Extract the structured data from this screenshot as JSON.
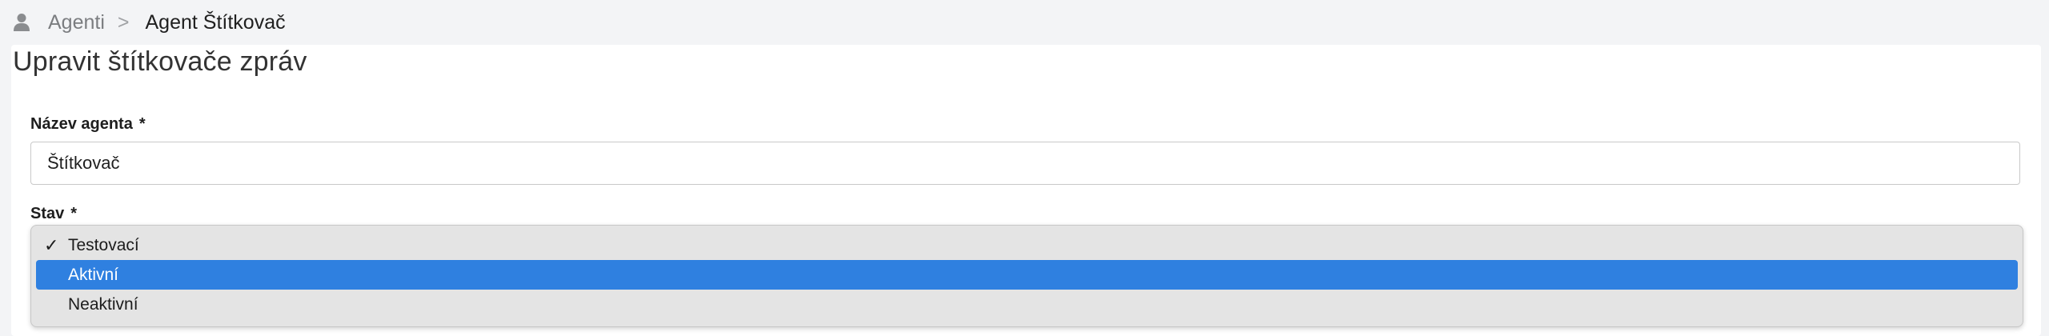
{
  "breadcrumb": {
    "parent": "Agenti",
    "separator": ">",
    "current": "Agent Štítkovač",
    "icon": "user-icon"
  },
  "page": {
    "title": "Upravit štítkovače zpráv"
  },
  "form": {
    "name_label": "Název agenta",
    "name_required": "*",
    "name_value": "Štítkovač",
    "status_label": "Stav",
    "status_required": "*"
  },
  "status_dropdown": {
    "checked": "Testovací",
    "highlighted": "Aktivní",
    "options": [
      {
        "label": "Testovací",
        "checked": true,
        "highlighted": false
      },
      {
        "label": "Aktivní",
        "checked": false,
        "highlighted": true
      },
      {
        "label": "Neaktivní",
        "checked": false,
        "highlighted": false
      }
    ],
    "check_mark": "✓",
    "highlight_color": "#2f80e0"
  }
}
